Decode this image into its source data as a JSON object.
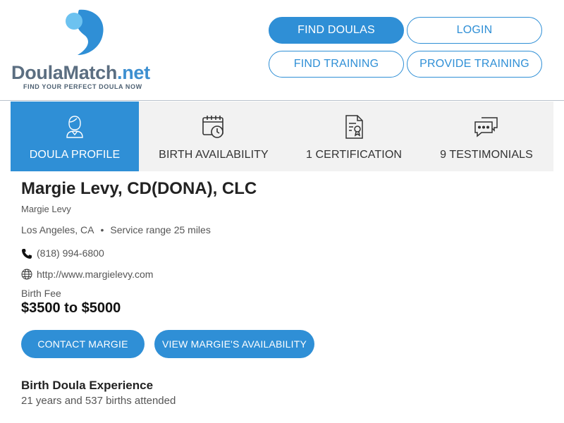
{
  "site": {
    "logo_text_main": "DoulaMatch",
    "logo_text_ext": ".net",
    "tagline": "FIND YOUR PERFECT DOULA NOW",
    "brand_color": "#2f8fd6"
  },
  "nav": {
    "find_doulas": "FIND DOULAS",
    "login": "LOGIN",
    "find_training": "FIND TRAINING",
    "provide_training": "PROVIDE TRAINING"
  },
  "tabs": [
    {
      "label": "DOULA PROFILE",
      "icon": "doula-person-icon",
      "active": true
    },
    {
      "label": "BIRTH AVAILABILITY",
      "icon": "calendar-clock-icon",
      "active": false
    },
    {
      "label": "1 CERTIFICATION",
      "icon": "certificate-icon",
      "active": false
    },
    {
      "label": "9 TESTIMONIALS",
      "icon": "chat-bubbles-icon",
      "active": false
    }
  ],
  "profile": {
    "name": "Margie Levy, CD(DONA), CLC",
    "subname": "Margie Levy",
    "location": "Los Angeles, CA",
    "service_range": "Service range 25 miles",
    "phone": "(818) 994-6800",
    "website": "http://www.margielevy.com",
    "fee_label": "Birth Fee",
    "fee_value": "$3500 to $5000",
    "contact_button": "CONTACT MARGIE",
    "availability_button": "VIEW MARGIE'S AVAILABILITY",
    "experience_title": "Birth Doula Experience",
    "experience_text": "21 years and 537 births attended"
  }
}
